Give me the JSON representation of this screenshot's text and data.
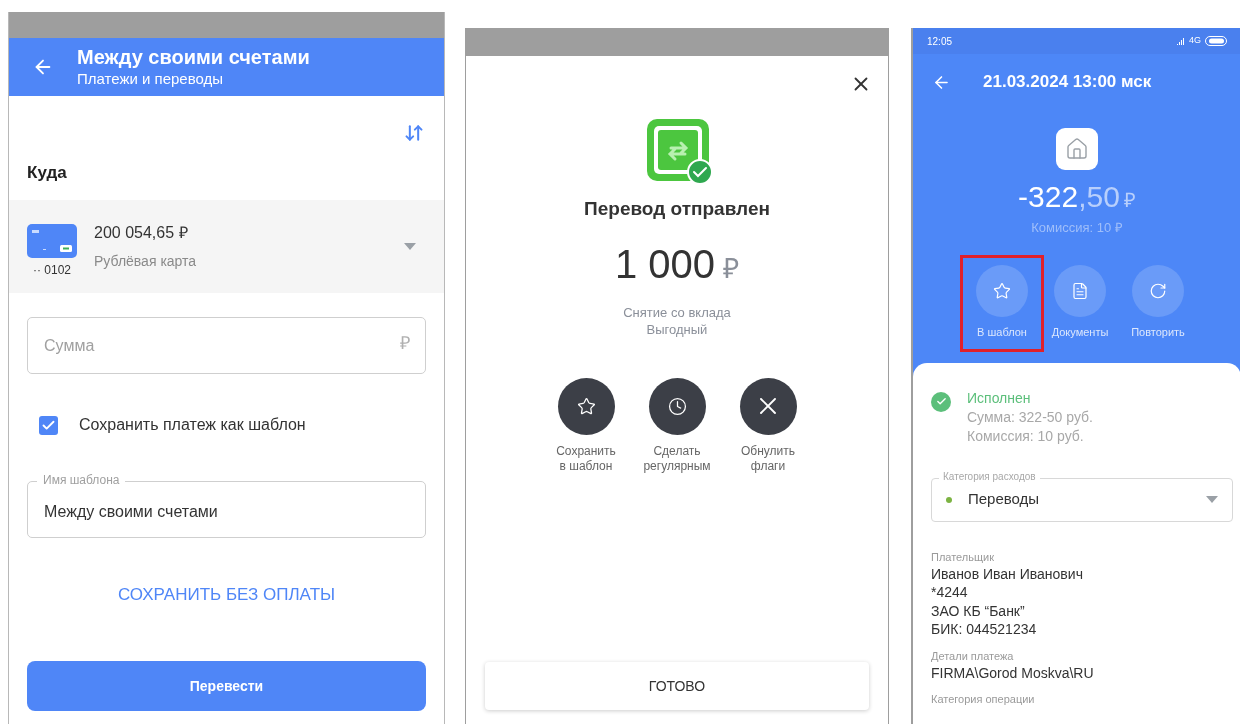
{
  "transfer_form": {
    "title": "Между своими счетами",
    "subtitle": "Платежи и переводы",
    "section_title": "Куда",
    "account": {
      "balance": "200 054,65 ₽",
      "name": "Рублёвая карта",
      "card_number": "·· 0102"
    },
    "amount_field": {
      "placeholder": "Сумма",
      "currency": "₽"
    },
    "save_template": {
      "label": "Сохранить платеж как шаблон",
      "checked": true
    },
    "template_name_field": {
      "label": "Имя шаблона",
      "value": "Между своими счетами"
    },
    "save_link": "СОХРАНИТЬ БЕЗ ОПЛАТЫ",
    "submit_button": "Перевести"
  },
  "transfer_success": {
    "title": "Перевод отправлен",
    "amount": "1 000",
    "currency": "₽",
    "description": [
      "Снятие со вклада",
      "Выгодный"
    ],
    "actions": [
      {
        "label": "Сохранить\nв шаблон",
        "kind": "star"
      },
      {
        "label": "Сделать\nрегулярным",
        "kind": "clock"
      },
      {
        "label": "Обнулить\nфлаги",
        "kind": "cross"
      }
    ],
    "done_button": "ГОТОВО"
  },
  "operation_details": {
    "status_bar": {
      "time": "12:05",
      "network": "4G"
    },
    "title": "21.03.2024 13:00 мск",
    "amount_main": "-322",
    "amount_fraction": ",50",
    "currency": "₽",
    "commission": "Комиссия: 10 ₽",
    "actions": [
      {
        "label": "В шаблон",
        "kind": "star",
        "highlighted": true
      },
      {
        "label": "Документы",
        "kind": "document",
        "highlighted": false
      },
      {
        "label": "Повторить",
        "kind": "repeat",
        "highlighted": false
      }
    ],
    "status": {
      "label": "Исполнен",
      "lines": [
        "Сумма: 322-50 руб.",
        "Комиссия: 10 руб."
      ]
    },
    "category_field": {
      "label": "Категория расходов",
      "value": "Переводы",
      "color": "#7cb342"
    },
    "fields": [
      {
        "label": "Плательщик",
        "lines": [
          "Иванов Иван Иванович",
          "*4244",
          "ЗАО КБ “Банк”",
          "БИК: 044521234"
        ]
      },
      {
        "label": "Детали платежа",
        "lines": [
          "FIRMA\\Gorod Moskva\\RU"
        ]
      },
      {
        "label": "Категория операции"
      }
    ]
  }
}
